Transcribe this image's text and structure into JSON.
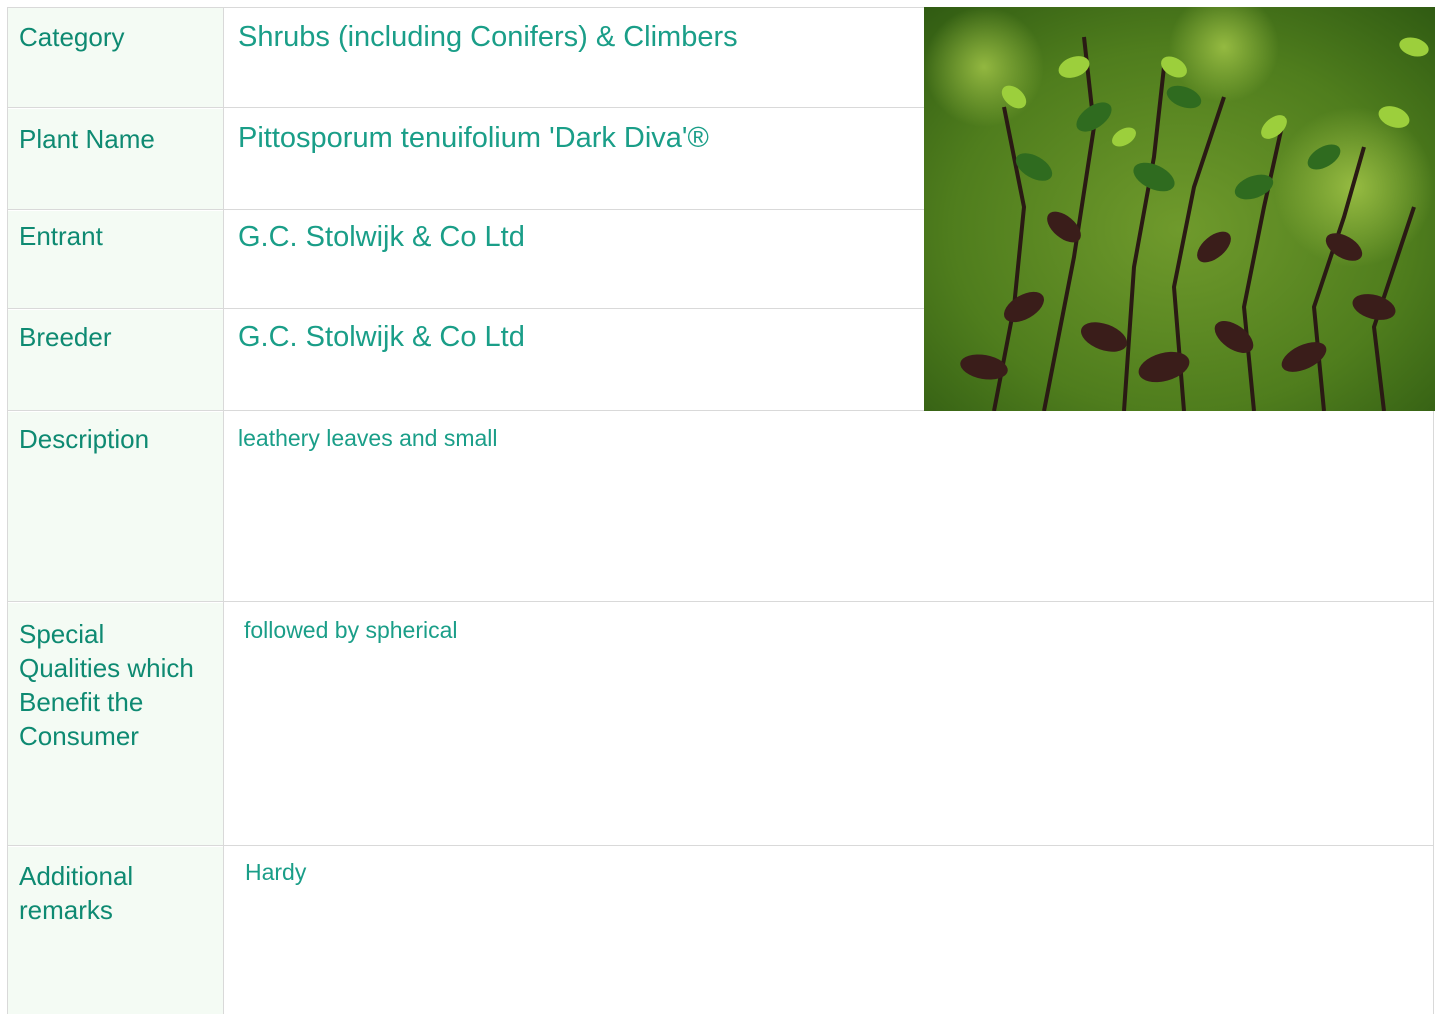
{
  "rows": [
    {
      "label": "Category",
      "value": "Shrubs (including Conifers) & Climbers"
    },
    {
      "label": "Plant Name",
      "value": "Pittosporum tenuifolium 'Dark Diva'®"
    },
    {
      "label": "Entrant",
      "value": "G.C. Stolwijk & Co Ltd"
    },
    {
      "label": "Breeder",
      "value": "G.C. Stolwijk & Co Ltd"
    },
    {
      "label": "Description",
      "value": "leathery leaves and small"
    },
    {
      "label": "Special Qualities which Benefit the Consumer",
      "value": "followed by spherical"
    },
    {
      "label": "Additional remarks",
      "value": "Hardy"
    }
  ],
  "colors": {
    "label_text": "#0e8a72",
    "value_text": "#1a9e88",
    "label_background": "#f4fbf4",
    "border": "#d9d9d9"
  }
}
